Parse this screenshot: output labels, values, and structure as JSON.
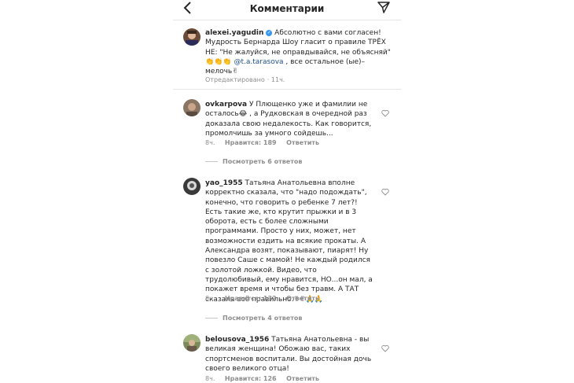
{
  "header": {
    "title": "Комментарии",
    "back_icon": "chevron-left-icon",
    "share_icon": "send-icon"
  },
  "comments": [
    {
      "username": "alexei.yagudin",
      "verified": true,
      "lines": [
        "Абсолютно с вами согласен!",
        "Мудрость Бернарда Шоу гласит о правиле ТРЁХ",
        "НЕ: \"Не жалуйся, не оправдывайся, не объясняй\"",
        "👏👏👏 @t.a.tarasova , все остальное (ые)–",
        "мелочь✌"
      ],
      "mention": "@t.a.tarasova",
      "edited": "Отредактировано",
      "time": "11ч."
    },
    {
      "username": "ovkarpova",
      "lines": [
        "У Плющенко уже и фамилии не",
        "осталось😂 , а Рудковская в очередной раз",
        "доказала свою недалекость. Как говорится,",
        "промолчишь за умного сойдешь..."
      ],
      "time": "8ч.",
      "likes": "Нравится: 189",
      "reply": "Ответить",
      "more_replies": "Посмотреть 6 ответов"
    },
    {
      "username": "yao_1955",
      "lines": [
        "Татьяна Анатольевна вполне",
        "корректно сказала, что \"надо подождать\",",
        "конечно, что говорить о ребенке 7 лет?!",
        "Есть такие же, кто крутит прыжки и в 3",
        "оборота, есть с более сложными",
        "программами.  Просто у них, может, нет",
        "возможности ездить на всякие прокаты. А",
        "Александра возят, показывают, пиарят! Ну",
        "повезло Саше с мамой! Не каждый родился",
        "с золотой ложкой. Видео, что",
        "трудолюбивый, ему нравится, НО...он мал, а",
        "покажет время и чтобы без травм. А  ТАТ",
        "сказала всё правильно.✌✌🙏🙏"
      ],
      "time": "8ч.",
      "likes": "Нравится: 132",
      "reply": "Ответить",
      "more_replies": "Посмотреть 4 ответов"
    },
    {
      "username": "belousova_1956",
      "lines": [
        "Татьяна Анатольевна - вы",
        "великая женщина! Обожаю вас, таких",
        "спортсменов воспитали. Вы достойная дочь",
        "своего великого отца!"
      ],
      "time": "8ч.",
      "likes": "Нравится: 126",
      "reply": "Ответить"
    }
  ],
  "colors": {
    "text": "#262626",
    "secondary": "#8e8e8e",
    "mention": "#1f4f8e",
    "verified": "#3897f0"
  }
}
